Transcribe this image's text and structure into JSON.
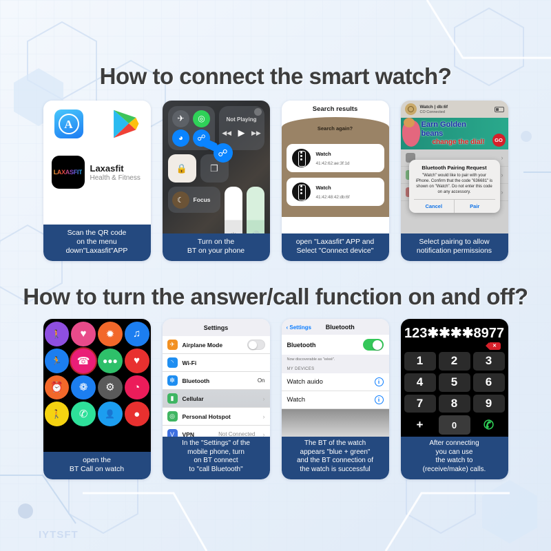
{
  "watermark": "IYTSFT",
  "sections": [
    {
      "title": "How to connect the smart watch?"
    },
    {
      "title": "How to turn the answer/call function on and off?"
    }
  ],
  "cards": {
    "card1": {
      "caption": "Scan the QR code\non the menu\ndown\"Laxasfit\"APP",
      "appstore_icon": "app-store-icon",
      "appstore_glyph": "A",
      "googleplay_icon": "google-play-icon",
      "app_icon_text": "LAXASFIT",
      "app_name": "Laxasfit",
      "app_category": "Health & Fitness"
    },
    "card2": {
      "caption": "Turn on the\nBT on your phone",
      "media_status": "Not Playing",
      "focus_label": "Focus",
      "toggles": [
        "airplane-mode",
        "cellular-data",
        "wifi",
        "bluetooth"
      ],
      "bluetooth_highlight": true
    },
    "card3": {
      "caption": "open \"Laxasfit\" APP and\nSelect \"Connect device\"",
      "title": "Search results",
      "search_again": "Search again?",
      "devices": [
        {
          "name": "Watch",
          "mac": "41:42:62:ae:3f:1d"
        },
        {
          "name": "Watch",
          "mac": "41:42:48:42:db:6f"
        }
      ]
    },
    "card4": {
      "caption": "Select pairing to allow\nnotification permissions",
      "status_name": "Watch | db:6f",
      "status_sub": "CO  Connected",
      "banner_line1": "Earn Golden",
      "banner_line2": "beans",
      "banner_line3": "change the dial!",
      "banner_go": "GO",
      "dialog_title": "Bluetooth Pairing Request",
      "dialog_body": "\"Watch\" would like to pair with your iPhone. Confirm that the code \"636681\" is shown on \"Watch\". Do not enter this code on any accessory.",
      "dialog_cancel": "Cancel",
      "dialog_pair": "Pair"
    },
    "card5": {
      "caption": "open the\nBT Call on watch",
      "apps": [
        {
          "name": "walk-icon",
          "glyph": "🚶",
          "color": "#8e4fe0"
        },
        {
          "name": "heart-icon",
          "glyph": "♥",
          "color": "#e84b8a"
        },
        {
          "name": "sun-icon",
          "glyph": "✹",
          "color": "#f2682a"
        },
        {
          "name": "music-icon",
          "glyph": "♫",
          "color": "#1c7ef0"
        },
        {
          "name": "run-icon",
          "glyph": "🏃",
          "color": "#1c7ef0"
        },
        {
          "name": "phone-call-icon",
          "glyph": "☎",
          "color": "#ea1e77"
        },
        {
          "name": "message-icon",
          "glyph": "●●●",
          "color": "#2ec06a"
        },
        {
          "name": "heart2-icon",
          "glyph": "♥",
          "color": "#e8302f"
        },
        {
          "name": "alarm-icon",
          "glyph": "⏰",
          "color": "#f2682a"
        },
        {
          "name": "weather-icon",
          "glyph": "❁",
          "color": "#1c7ef0"
        },
        {
          "name": "settings-icon",
          "glyph": "⚙",
          "color": "#5a5a5a"
        },
        {
          "name": "spiral-icon",
          "glyph": "◔",
          "color": "#ec1c5a"
        },
        {
          "name": "pedometer-icon",
          "glyph": "🚶",
          "color": "#f5d311"
        },
        {
          "name": "dial-call-icon",
          "glyph": "✆",
          "color": "#2ee09a"
        },
        {
          "name": "contact-icon",
          "glyph": "👤",
          "color": "#1c9ef0"
        },
        {
          "name": "more-icon",
          "glyph": "●",
          "color": "#e8302f"
        }
      ],
      "highlight_index": 5
    },
    "card6": {
      "caption": "In the \"Settings\" of the\nmobile phone, turn\non BT connect\nto \"call Bluetooth\"",
      "title": "Settings",
      "rows": [
        {
          "label": "Airplane Mode",
          "icon": "airplane-icon",
          "icon_color": "#f29022",
          "value": "",
          "control": "toggle-off"
        },
        {
          "label": "Wi-Fi",
          "icon": "wifi-icon",
          "icon_color": "#1f8ef1",
          "value": "",
          "control": "none"
        },
        {
          "label": "Bluetooth",
          "icon": "bluetooth-icon",
          "icon_color": "#1f8ef1",
          "value": "On",
          "control": "value"
        },
        {
          "label": "Cellular",
          "icon": "cellular-icon",
          "icon_color": "#3fb562",
          "value": "",
          "control": "chevron"
        },
        {
          "label": "Personal Hotspot",
          "icon": "hotspot-icon",
          "icon_color": "#3fb562",
          "value": "",
          "control": "chevron"
        },
        {
          "label": "VPN",
          "icon": "vpn-icon",
          "icon_color": "#3d6fe0",
          "value": "Not Connected",
          "control": "chevron"
        }
      ]
    },
    "card7": {
      "caption": "The BT of the watch\nappears \"blue + green\"\nand the BT connection of\nthe watch is successful",
      "back": "Settings",
      "title": "Bluetooth",
      "bluetooth_label": "Bluetooth",
      "bluetooth_on": true,
      "hint": "Now discoverable as \"eéeé\".",
      "section": "MY DEVICES",
      "devices": [
        "Watch auido",
        "Watch"
      ]
    },
    "card8": {
      "caption": "After connecting\nyou can use\nthe watch to\n(receive/make) calls.",
      "number": "123✱✱✱✱8977",
      "delete_glyph": "✕",
      "keys": [
        "1",
        "2",
        "3",
        "4",
        "5",
        "6",
        "7",
        "8",
        "9",
        "+",
        "0",
        "✆"
      ]
    }
  }
}
